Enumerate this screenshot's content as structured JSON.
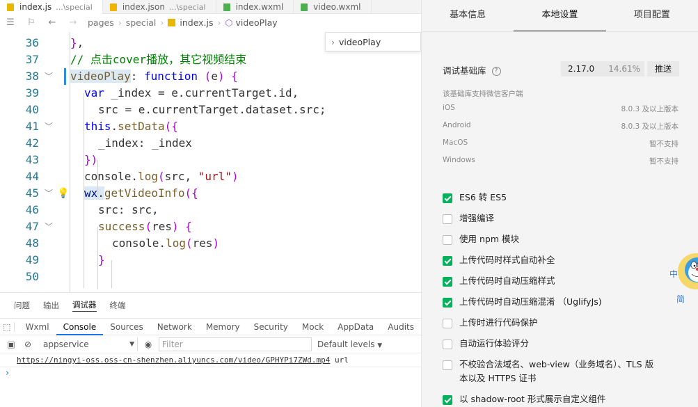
{
  "tabs": [
    {
      "name": "index.js",
      "sub": "...\\special",
      "color": "#e8b800",
      "active": true
    },
    {
      "name": "index.json",
      "sub": "...\\special",
      "color": "#f0b400",
      "active": false
    },
    {
      "name": "index.wxml",
      "sub": "",
      "color": "#4caf50",
      "active": false
    },
    {
      "name": "video.wxml",
      "sub": "",
      "color": "#4caf50",
      "active": false
    }
  ],
  "breadcrumb": {
    "items": [
      "pages",
      "special",
      "index.js",
      "videoPlay"
    ]
  },
  "peek": {
    "label": "videoPlay"
  },
  "code": {
    "line_numbers": [
      "36",
      "37",
      "38",
      "39",
      "40",
      "41",
      "42",
      "43",
      "44",
      "45",
      "46",
      "47",
      "48",
      "49",
      "50"
    ],
    "lines": [
      "},",
      "// 点击cover播放，其它视频结束",
      "videoPlay: function (e) {",
      "var _index = e.currentTarget.id,",
      "src = e.currentTarget.dataset.src;",
      "this.setData({",
      "_index: _index",
      "})",
      "console.log(src, \"url\")",
      "wx.getVideoInfo({",
      "src: src,",
      "success(res) {",
      "console.log(res)",
      "}",
      ""
    ]
  },
  "panel": {
    "tabs": [
      "问题",
      "输出",
      "调试器",
      "终端"
    ],
    "active_tab": "调试器",
    "devtools_tabs": [
      "Wxml",
      "Console",
      "Sources",
      "Network",
      "Memory",
      "Security",
      "Mock",
      "AppData",
      "Audits"
    ],
    "active_devtools_tab": "Console",
    "context": "appservice",
    "filter_placeholder": "Filter",
    "levels": "Default levels",
    "log_url": "https://ningyi-oss.oss-cn-shenzhen.aliyuncs.com/video/GPHYPi7ZWd.mp4",
    "log_suffix": "url",
    "prompt": "›"
  },
  "settings": {
    "tabs": [
      "基本信息",
      "本地设置",
      "项目配置"
    ],
    "active_tab": "本地设置",
    "debug_lib_label": "调试基础库",
    "debug_lib_version": "2.17.0",
    "debug_lib_percent": "14.61%",
    "push_label": "推送",
    "support_note": "该基础库支持微信客户端",
    "platforms": [
      {
        "name": "iOS",
        "value": "8.0.3 及以上版本"
      },
      {
        "name": "Android",
        "value": "8.0.3 及以上版本"
      },
      {
        "name": "MacOS",
        "value": "暂不支持"
      },
      {
        "name": "Windows",
        "value": "暂不支持"
      }
    ],
    "options": [
      {
        "label": "ES6 转 ES5",
        "checked": true
      },
      {
        "label": "增强编译",
        "checked": false
      },
      {
        "label": "使用 npm 模块",
        "checked": false
      },
      {
        "label": "上传代码时样式自动补全",
        "checked": true
      },
      {
        "label": "上传代码时自动压缩样式",
        "checked": true
      },
      {
        "label": "上传代码时自动压缩混淆 （UglifyJs)",
        "checked": true
      },
      {
        "label": "上传时进行代码保护",
        "checked": false
      },
      {
        "label": "自动运行体验评分",
        "checked": false
      },
      {
        "label": "不校验合法域名、web-view（业务域名）、TLS 版",
        "label2": "本以及 HTTPS 证书",
        "checked": false
      },
      {
        "label": "以 shadow-root 形式展示自定义组件",
        "checked": true
      }
    ]
  },
  "mascot_text": [
    "中",
    "简"
  ]
}
